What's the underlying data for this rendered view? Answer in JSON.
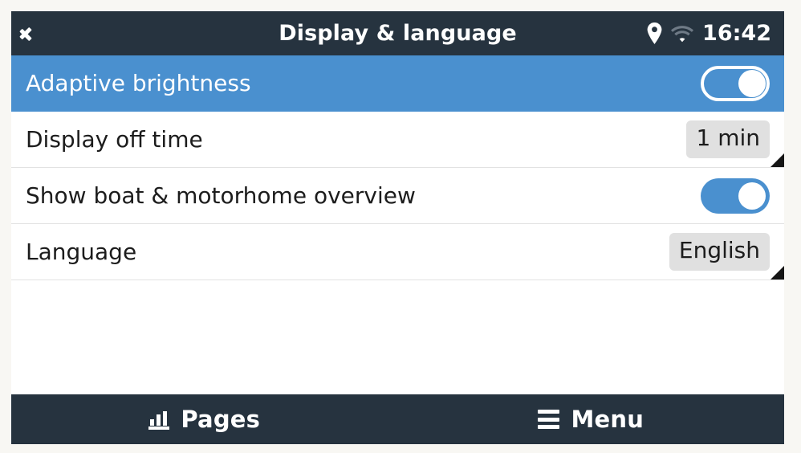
{
  "header": {
    "back_icon": "chevron-left-icon",
    "title": "Display & language",
    "status": {
      "location_icon": "location-pin-icon",
      "wifi_icon": "wifi-icon",
      "time": "16:42"
    }
  },
  "list": {
    "rows": [
      {
        "label": "Adaptive brightness",
        "control": "toggle",
        "toggle_state": "on",
        "selected": true,
        "has_corner_marker": false
      },
      {
        "label": "Display off time",
        "control": "value",
        "value": "1 min",
        "selected": false,
        "has_corner_marker": true
      },
      {
        "label": "Show boat & motorhome overview",
        "control": "toggle",
        "toggle_state": "on",
        "selected": false,
        "has_corner_marker": false
      },
      {
        "label": "Language",
        "control": "value",
        "value": "English",
        "selected": false,
        "has_corner_marker": true
      }
    ]
  },
  "footer": {
    "pages": {
      "icon": "bar-chart-icon",
      "label": "Pages"
    },
    "menu": {
      "icon": "hamburger-menu-icon",
      "label": "Menu"
    }
  },
  "colors": {
    "header_bg": "#26333f",
    "accent_blue": "#4a90cf",
    "row_bg": "#ffffff",
    "badge_bg": "#e0e0e0",
    "page_bg": "#f8f7f3",
    "text_dark": "#1c1c1c",
    "text_light": "#ffffff"
  }
}
